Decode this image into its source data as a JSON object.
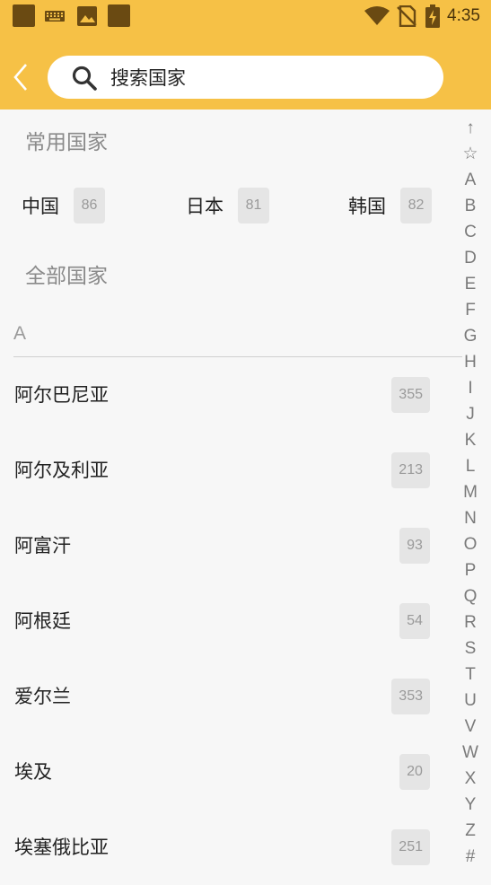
{
  "status_bar": {
    "time": "4:35"
  },
  "search": {
    "placeholder": "搜索国家",
    "value": ""
  },
  "common": {
    "title": "常用国家",
    "items": [
      {
        "name": "中国",
        "count": "86"
      },
      {
        "name": "日本",
        "count": "81"
      },
      {
        "name": "韩国",
        "count": "82"
      }
    ]
  },
  "all": {
    "title": "全部国家",
    "group_letter": "A",
    "items": [
      {
        "name": "阿尔巴尼亚",
        "count": "355"
      },
      {
        "name": "阿尔及利亚",
        "count": "213"
      },
      {
        "name": "阿富汗",
        "count": "93"
      },
      {
        "name": "阿根廷",
        "count": "54"
      },
      {
        "name": "爱尔兰",
        "count": "353"
      },
      {
        "name": "埃及",
        "count": "20"
      },
      {
        "name": "埃塞俄比亚",
        "count": "251"
      }
    ]
  },
  "index": [
    "↑",
    "☆",
    "A",
    "B",
    "C",
    "D",
    "E",
    "F",
    "G",
    "H",
    "I",
    "J",
    "K",
    "L",
    "M",
    "N",
    "O",
    "P",
    "Q",
    "R",
    "S",
    "T",
    "U",
    "V",
    "W",
    "X",
    "Y",
    "Z",
    "#"
  ],
  "colors": {
    "header": "#f6c146",
    "background": "#f7f7f7",
    "badge": "#e5e5e5"
  }
}
